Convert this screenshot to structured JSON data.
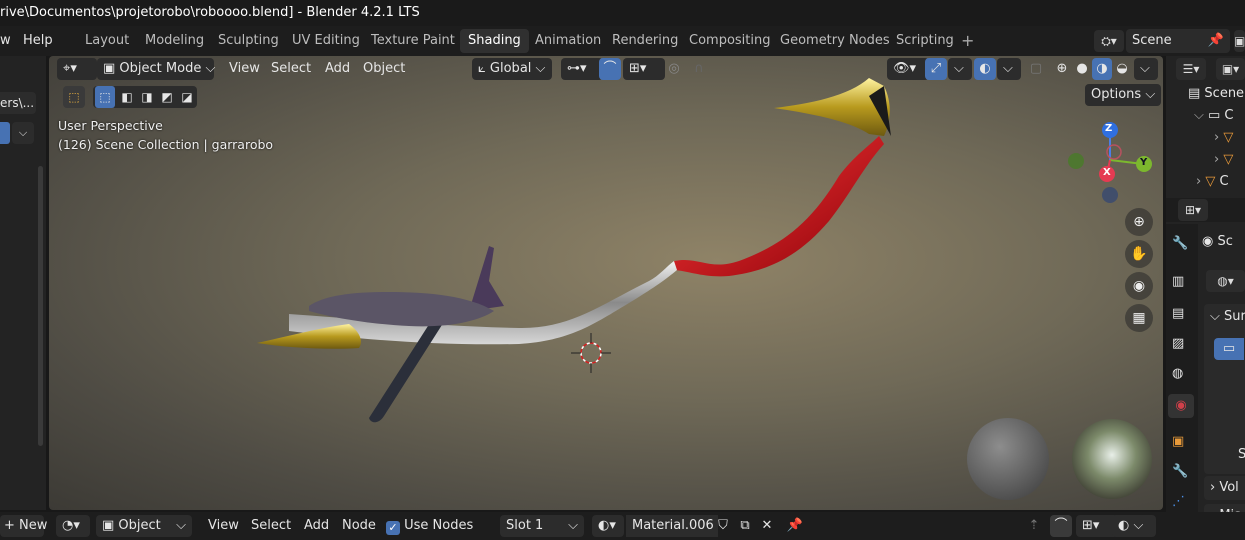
{
  "title": "rive\\Documentos\\projetorobo\\roboooo.blend] - Blender 4.2.1 LTS",
  "menu": {
    "window": "w",
    "help": "Help"
  },
  "workspace_tabs": [
    "Layout",
    "Modeling",
    "Sculpting",
    "UV Editing",
    "Texture Paint",
    "Shading",
    "Animation",
    "Rendering",
    "Compositing",
    "Geometry Nodes",
    "Scripting"
  ],
  "active_tab": "Shading",
  "add_tab": "+",
  "scene": {
    "label": "Scene",
    "outliner_scene": "Scene",
    "props_scene": "Sc"
  },
  "left_panel": {
    "path_label": "ers\\..."
  },
  "viewport_header": {
    "mode": "Object Mode",
    "view": "View",
    "select": "Select",
    "add": "Add",
    "object": "Object",
    "transform": "Global",
    "options": "Options"
  },
  "viewport": {
    "perspective": "User Perspective",
    "collection": "(126) Scene Collection | garrarobo",
    "gizmo": {
      "z": "Z",
      "y": "Y",
      "x": "X"
    }
  },
  "outliner_items": [
    "C",
    "C"
  ],
  "properties": {
    "surface": "Sur",
    "volume": "Vol",
    "misc": "Mis",
    "s": "S"
  },
  "bottom_bar": {
    "new": "New",
    "object": "Object",
    "view": "View",
    "select": "Select",
    "add": "Add",
    "node": "Node",
    "use_nodes": "Use Nodes",
    "slot": "Slot 1",
    "material": "Material.006"
  },
  "colors": {
    "accent": "#4772b3",
    "red": "#c8102e"
  }
}
